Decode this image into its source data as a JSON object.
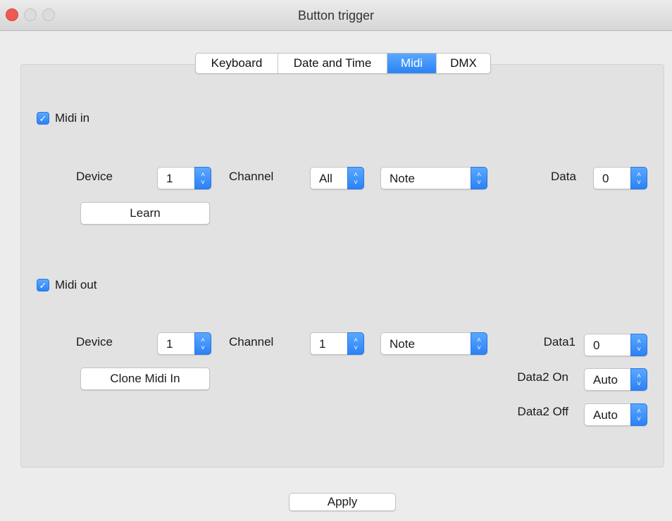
{
  "window": {
    "title": "Button trigger"
  },
  "tabs": [
    {
      "label": "Keyboard"
    },
    {
      "label": "Date and Time"
    },
    {
      "label": "Midi",
      "active": true
    },
    {
      "label": "DMX"
    }
  ],
  "midi_in": {
    "checkbox_label": "Midi in",
    "checked": true,
    "device_label": "Device",
    "device_value": "1",
    "channel_label": "Channel",
    "channel_value": "All",
    "type_value": "Note",
    "data_label": "Data",
    "data_value": "0",
    "learn_label": "Learn"
  },
  "midi_out": {
    "checkbox_label": "Midi out",
    "checked": true,
    "device_label": "Device",
    "device_value": "1",
    "channel_label": "Channel",
    "channel_value": "1",
    "type_value": "Note",
    "data1_label": "Data1",
    "data1_value": "0",
    "data2_on_label": "Data2 On",
    "data2_on_value": "Auto",
    "data2_off_label": "Data2 Off",
    "data2_off_value": "Auto",
    "clone_label": "Clone Midi In"
  },
  "footer": {
    "apply_label": "Apply"
  },
  "colors": {
    "accent": "#2c82f5",
    "close_button": "#ee5a52"
  },
  "icons": {
    "checkmark": "check-icon",
    "stepper": "up-down-chevron-icon"
  }
}
